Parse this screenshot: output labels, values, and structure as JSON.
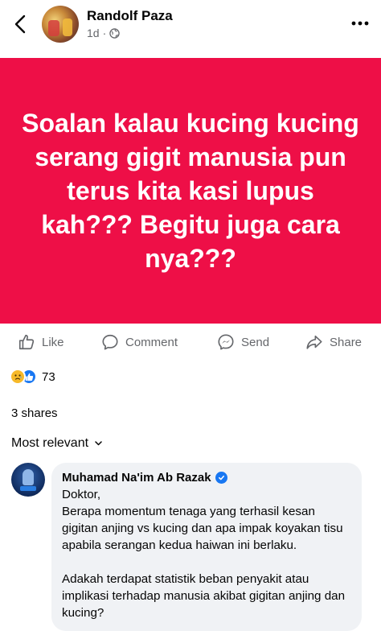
{
  "post": {
    "author": "Randolf Paza",
    "time": "1d",
    "privacy_icon": "globe-icon"
  },
  "banner": {
    "text": "Soalan kalau kucing kucing serang gigit manusia pun terus kita kasi lupus kah??? Begitu juga cara nya???",
    "background": "#ee0f47"
  },
  "actions": {
    "like": "Like",
    "comment": "Comment",
    "send": "Send",
    "share": "Share"
  },
  "reactions": {
    "icons": [
      "sad-reaction-icon",
      "like-reaction-icon"
    ],
    "count": "73"
  },
  "shares": "3 shares",
  "sort_label": "Most relevant",
  "comment": {
    "author": "Muhamad Na'im Ab Razak",
    "verified": true,
    "lines": [
      "Doktor,",
      "Berapa momentum tenaga yang terhasil kesan gigitan anjing vs kucing dan apa impak koyakan tisu apabila serangan kedua haiwan ini berlaku.",
      "Adakah terdapat statistik beban penyakit atau implikasi terhadap manusia akibat gigitan anjing dan kucing?"
    ]
  }
}
